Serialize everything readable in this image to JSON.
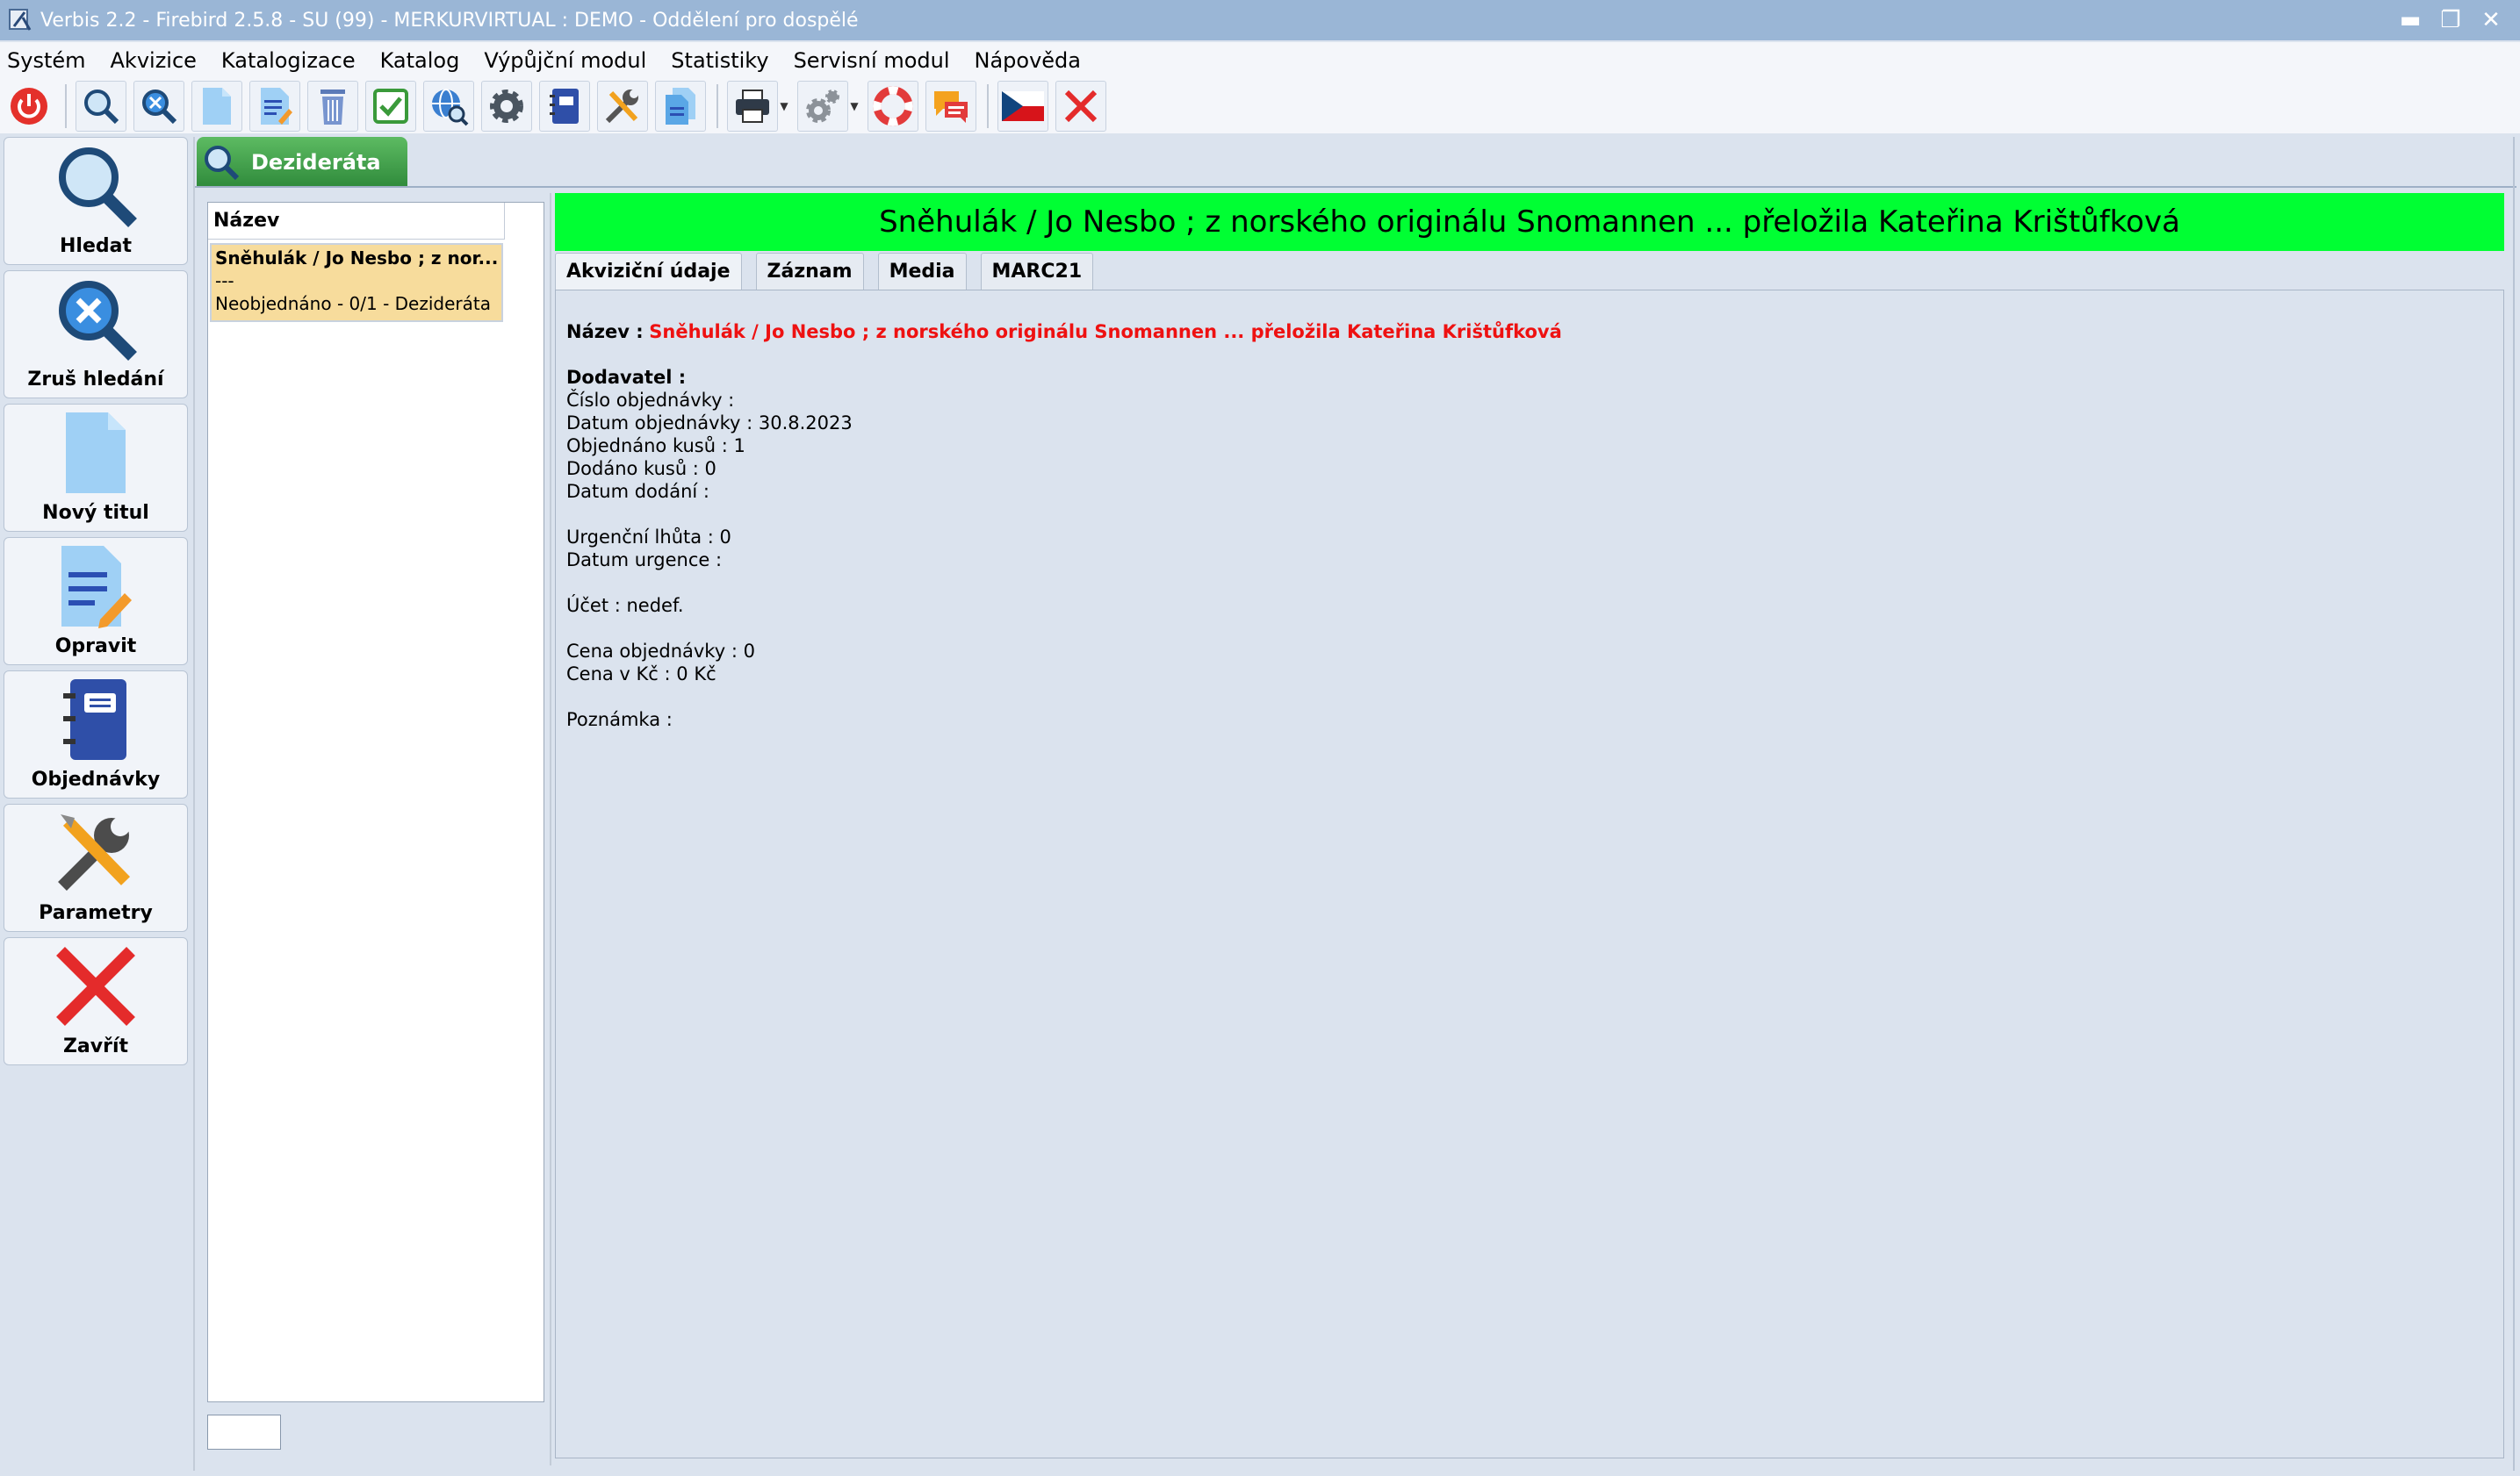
{
  "window": {
    "title": "Verbis 2.2 - Firebird 2.5.8 - SU (99) - MERKURVIRTUAL : DEMO - Oddělení pro dospělé",
    "minimize": "▬",
    "maximize": "❐",
    "close": "✕"
  },
  "menu": [
    "Systém",
    "Akvizice",
    "Katalogizace",
    "Katalog",
    "Výpůjční modul",
    "Statistiky",
    "Servisní modul",
    "Nápověda"
  ],
  "sidebar": {
    "search_label": "Hledat",
    "cancel_search_label": "Zruš hledání",
    "new_title_label": "Nový titul",
    "edit_label": "Opravit",
    "orders_label": "Objednávky",
    "parameters_label": "Parametry",
    "close_label": "Zavřít"
  },
  "doc_tab": {
    "label": "Dezideráta"
  },
  "list": {
    "header": "Název",
    "rows": [
      {
        "line1": "Sněhulák / Jo Nesbo ; z nor...",
        "line2": "---",
        "line3": "Neobjednáno - 0/1 - Dezideráta"
      }
    ],
    "filter_value": ""
  },
  "detail": {
    "title": "Sněhulák / Jo Nesbo ; z norského originálu Snomannen ... přeložila Kateřina Krištůfková",
    "tabs": [
      "Akviziční údaje",
      "Záznam",
      "Media",
      "MARC21"
    ],
    "name_label": "Název :",
    "name_value": "Sněhulák / Jo Nesbo ; z norského originálu Snomannen ... přeložila Kateřina Krištůfková",
    "supplier": "Dodavatel :",
    "order_number": "Číslo objednávky :",
    "order_date": "Datum objednávky : 30.8.2023",
    "ordered_count": "Objednáno kusů : 1",
    "delivered_count": "Dodáno kusů : 0",
    "delivery_date": "Datum dodání :",
    "urgency_period": "Urgenční lhůta : 0",
    "urgency_date": "Datum urgence :",
    "account": "Účet : nedef.",
    "order_price": "Cena objednávky : 0",
    "price_czk": "Cena v Kč : 0 Kč",
    "note": "Poznámka :"
  },
  "colors": {
    "title_bar": "#9ab6d6",
    "detail_title_bg": "#00ff33",
    "selected_row": "#f7dc9c",
    "name_value": "#ee1111",
    "tab_green": "#2f8a3b"
  }
}
